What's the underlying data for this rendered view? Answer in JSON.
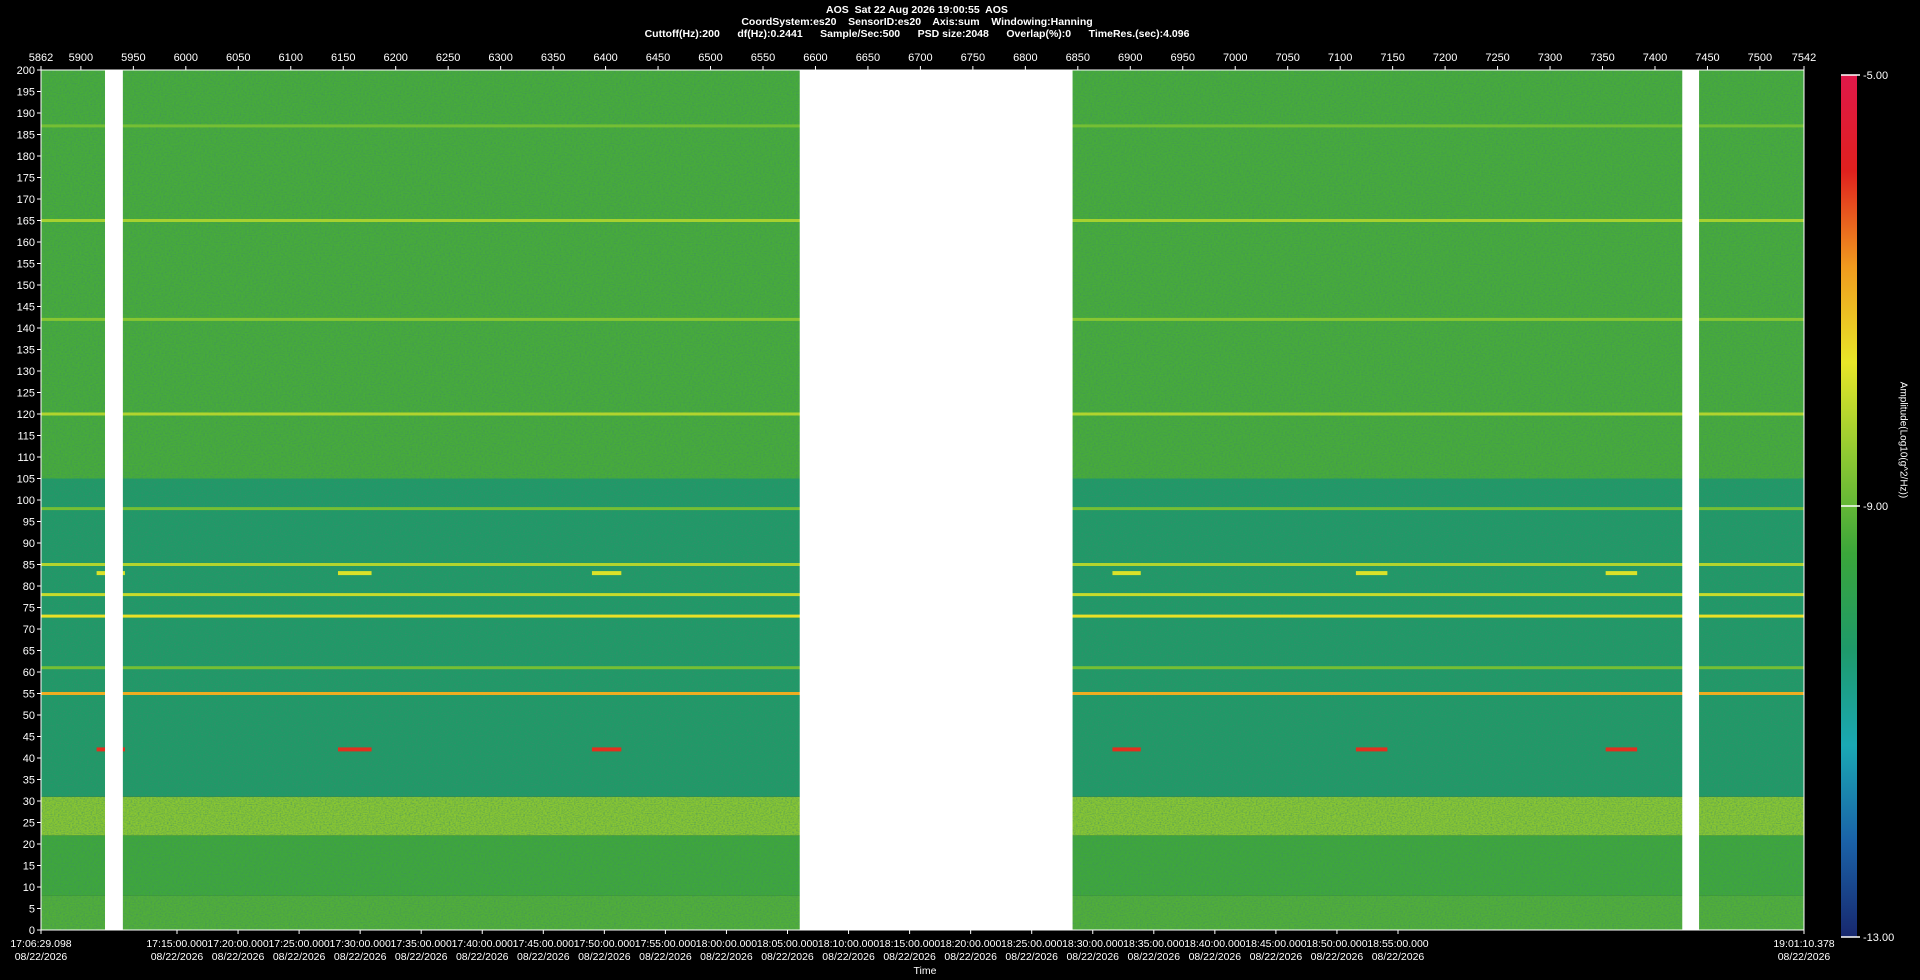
{
  "header": {
    "line1": "AOS  Sat 22 Aug 2026 19:00:55  AOS",
    "line2": "CoordSystem:es20    SensorID:es20    Axis:sum    Windowing:Hanning",
    "line3": "Cuttoff(Hz):200      df(Hz):0.2441      Sample/Sec:500      PSD size:2048      Overlap(%):0      TimeRes.(sec):4.096"
  },
  "colors": {
    "background": "#000000",
    "text": "#ffffff",
    "gap": "#ffffff",
    "colormap": [
      "#18286e",
      "#1a62a8",
      "#1aa8b4",
      "#1e9a6a",
      "#3aa63a",
      "#8cc832",
      "#e8e628",
      "#f09a1e",
      "#e0201e",
      "#e0184a"
    ]
  },
  "chart_data": {
    "type": "heatmap",
    "title": "AOS  Sat 22 Aug 2026 19:00:55  AOS",
    "xlabel": "Time",
    "ylabel": "",
    "top_axis": {
      "range": [
        5862,
        7542
      ],
      "ticks": [
        5862,
        5900,
        5950,
        6000,
        6050,
        6100,
        6150,
        6200,
        6250,
        6300,
        6350,
        6400,
        6450,
        6500,
        6550,
        6600,
        6650,
        6700,
        6750,
        6800,
        6850,
        6900,
        6950,
        7000,
        7050,
        7100,
        7150,
        7200,
        7250,
        7300,
        7350,
        7400,
        7450,
        7500,
        7542
      ]
    },
    "ylim": [
      0,
      200
    ],
    "yticks": [
      0,
      5,
      10,
      15,
      20,
      25,
      30,
      35,
      40,
      45,
      50,
      55,
      60,
      65,
      70,
      75,
      80,
      85,
      90,
      95,
      100,
      105,
      110,
      115,
      120,
      125,
      130,
      135,
      140,
      145,
      150,
      155,
      160,
      165,
      170,
      175,
      180,
      185,
      190,
      195,
      200
    ],
    "time_ticks": [
      {
        "time": "17:06:29.098",
        "date": "08/22/2026"
      },
      {
        "time": "17:15:00.000",
        "date": "08/22/2026"
      },
      {
        "time": "17:20:00.000",
        "date": "08/22/2026"
      },
      {
        "time": "17:25:00.000",
        "date": "08/22/2026"
      },
      {
        "time": "17:30:00.000",
        "date": "08/22/2026"
      },
      {
        "time": "17:35:00.000",
        "date": "08/22/2026"
      },
      {
        "time": "17:40:00.000",
        "date": "08/22/2026"
      },
      {
        "time": "17:45:00.000",
        "date": "08/22/2026"
      },
      {
        "time": "17:50:00.000",
        "date": "08/22/2026"
      },
      {
        "time": "17:55:00.000",
        "date": "08/22/2026"
      },
      {
        "time": "18:00:00.000",
        "date": "08/22/2026"
      },
      {
        "time": "18:05:00.000",
        "date": "08/22/2026"
      },
      {
        "time": "18:10:00.000",
        "date": "08/22/2026"
      },
      {
        "time": "18:15:00.000",
        "date": "08/22/2026"
      },
      {
        "time": "18:20:00.000",
        "date": "08/22/2026"
      },
      {
        "time": "18:25:00.000",
        "date": "08/22/2026"
      },
      {
        "time": "18:30:00.000",
        "date": "08/22/2026"
      },
      {
        "time": "18:35:00.000",
        "date": "08/22/2026"
      },
      {
        "time": "18:40:00.000",
        "date": "08/22/2026"
      },
      {
        "time": "18:45:00.000",
        "date": "08/22/2026"
      },
      {
        "time": "18:50:00.000",
        "date": "08/22/2026"
      },
      {
        "time": "18:55:00.000",
        "date": "08/22/2026"
      },
      {
        "time": "19:01:10.378",
        "date": "08/22/2026"
      }
    ],
    "data_gaps_top_axis": [
      [
        5923,
        5940
      ],
      [
        6585,
        6845
      ],
      [
        7426,
        7442
      ]
    ],
    "bands": [
      {
        "freq": [
          0,
          8
        ],
        "level": -9.2
      },
      {
        "freq": [
          8,
          22
        ],
        "level": -9.4
      },
      {
        "freq": [
          22,
          31
        ],
        "level": -8.6
      },
      {
        "freq": [
          31,
          105
        ],
        "level": -10.3
      },
      {
        "freq": [
          105,
          200
        ],
        "level": -9.3
      }
    ],
    "lines_hz": [
      {
        "freq": 55,
        "level": -7.0
      },
      {
        "freq": 73,
        "level": -7.6
      },
      {
        "freq": 78,
        "level": -8.0
      },
      {
        "freq": 85,
        "level": -8.2
      },
      {
        "freq": 61,
        "level": -8.8
      },
      {
        "freq": 98,
        "level": -8.8
      },
      {
        "freq": 120,
        "level": -8.2
      },
      {
        "freq": 142,
        "level": -8.6
      },
      {
        "freq": 165,
        "level": -8.3
      },
      {
        "freq": 187,
        "level": -8.8
      }
    ],
    "bursts": [
      {
        "x": [
          5915,
          5942
        ],
        "freq": 42,
        "level": -6.0
      },
      {
        "x": [
          6145,
          6177
        ],
        "freq": 42,
        "level": -6.0
      },
      {
        "x": [
          6387,
          6415
        ],
        "freq": 42,
        "level": -6.0
      },
      {
        "x": [
          6883,
          6910
        ],
        "freq": 42,
        "level": -6.0
      },
      {
        "x": [
          7115,
          7145
        ],
        "freq": 42,
        "level": -6.0
      },
      {
        "x": [
          7353,
          7383
        ],
        "freq": 42,
        "level": -6.0
      },
      {
        "x": [
          5915,
          5942
        ],
        "freq": 83,
        "level": -7.8
      },
      {
        "x": [
          6145,
          6177
        ],
        "freq": 83,
        "level": -7.8
      },
      {
        "x": [
          6387,
          6415
        ],
        "freq": 83,
        "level": -7.8
      },
      {
        "x": [
          6883,
          6910
        ],
        "freq": 83,
        "level": -7.8
      },
      {
        "x": [
          7115,
          7145
        ],
        "freq": 83,
        "level": -7.8
      },
      {
        "x": [
          7353,
          7383
        ],
        "freq": 83,
        "level": -7.8
      }
    ],
    "colorbar": {
      "label": "Amplitude(Log10(g^2/Hz))",
      "range": [
        -13.0,
        -5.0
      ],
      "ticks": [
        "-5.00",
        "-9.00",
        "-13.00"
      ]
    }
  }
}
